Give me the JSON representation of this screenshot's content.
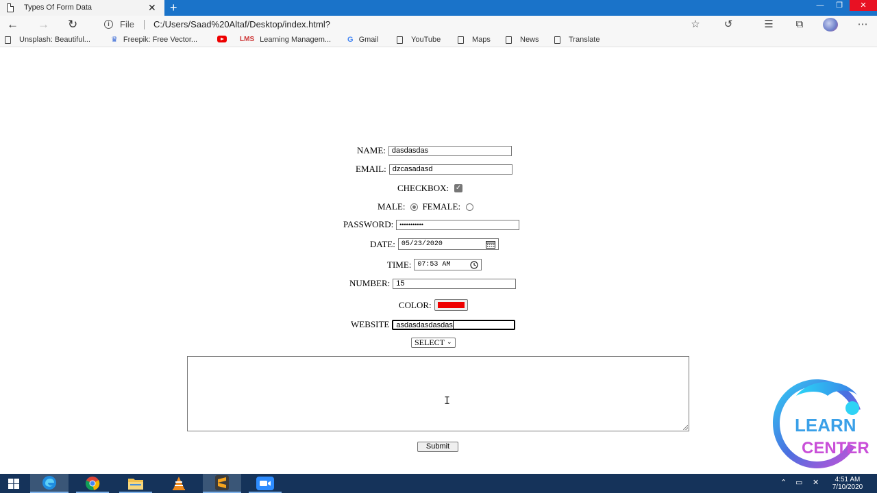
{
  "browser": {
    "tab_title": "Types Of Form Data",
    "tab_close": "✕",
    "new_tab": "+",
    "address": {
      "file_label": "File",
      "url": "C:/Users/Saad%20Altaf/Desktop/index.html?"
    },
    "favorites": [
      {
        "label": "Unsplash: Beautiful...",
        "icon": "page-icon"
      },
      {
        "label": "Freepik: Free Vector...",
        "icon": "freepik-icon"
      },
      {
        "label": "",
        "icon": "youtube-icon"
      },
      {
        "label": "Learning Managem...",
        "icon": "lms-icon"
      },
      {
        "label": "Gmail",
        "icon": "google-icon"
      },
      {
        "label": "YouTube",
        "icon": "page-icon"
      },
      {
        "label": "Maps",
        "icon": "page-icon"
      },
      {
        "label": "News",
        "icon": "page-icon"
      },
      {
        "label": "Translate",
        "icon": "page-icon"
      }
    ]
  },
  "form": {
    "name": {
      "label": "NAME:",
      "value": "dasdasdas"
    },
    "email": {
      "label": "EMAIL:",
      "value": "dzcasadasd"
    },
    "checkbox": {
      "label": "CHECKBOX:",
      "checked": true
    },
    "gender": {
      "male_label": "MALE:",
      "female_label": "FEMALE:",
      "selected": "male"
    },
    "password": {
      "label": "PASSWORD:",
      "value": "•••••••••••"
    },
    "date": {
      "label": "DATE:",
      "value": "05/23/2020"
    },
    "time": {
      "label": "TIME:",
      "value": "07:53 AM"
    },
    "number": {
      "label": "NUMBER:",
      "value": "15"
    },
    "color": {
      "label": "COLOR:",
      "value": "#ee0000"
    },
    "website": {
      "label": "WEBSITE",
      "value": "asdasdasdasdas"
    },
    "select": {
      "value": "SELECT"
    },
    "submit_label": "Submit"
  },
  "logo": {
    "line1": "LEARN",
    "line2": "CENTER"
  },
  "taskbar": {
    "time": "4:51 AM",
    "date": "7/10/2020"
  }
}
